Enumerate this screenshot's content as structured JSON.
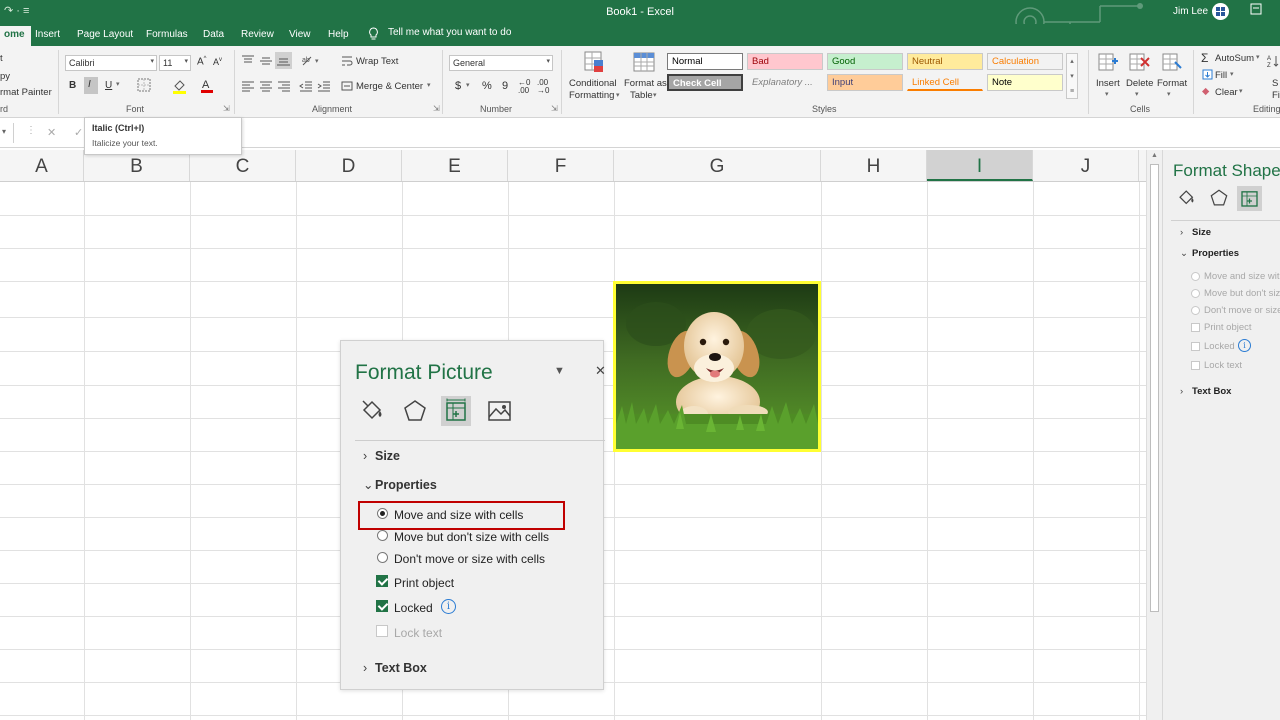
{
  "titlebar": {
    "title": "Book1  -  Excel",
    "user": "Jim Lee",
    "qa": "↷ ·  ≡"
  },
  "tabs": [
    {
      "label": "ome",
      "active": true
    },
    {
      "label": "Insert"
    },
    {
      "label": "Page Layout"
    },
    {
      "label": "Formulas"
    },
    {
      "label": "Data"
    },
    {
      "label": "Review"
    },
    {
      "label": "View"
    },
    {
      "label": "Help"
    }
  ],
  "tell_me": "Tell me what you want to do",
  "ribbon": {
    "clipboard": {
      "cut": "t",
      "copy": "py",
      "painter": "rmat Painter",
      "label": "rd"
    },
    "font": {
      "name": "Calibri",
      "size": "11",
      "bold": "B",
      "italic": "I",
      "underline": "U",
      "label": "Font"
    },
    "alignment": {
      "wrap": "Wrap Text",
      "merge": "Merge & Center",
      "label": "Alignment"
    },
    "number": {
      "format": "General",
      "currency": "$",
      "percent": "%",
      "comma": "9",
      "label": "Number"
    },
    "conditional": {
      "line1": "Conditional",
      "line2": "Formatting"
    },
    "format_table": {
      "line1": "Format as",
      "line2": "Table"
    },
    "styles": {
      "label": "Styles",
      "cells": [
        {
          "text": "Normal",
          "bg": "#ffffff",
          "color": "#000000"
        },
        {
          "text": "Bad",
          "bg": "#ffc7ce",
          "color": "#9c0006"
        },
        {
          "text": "Good",
          "bg": "#c6efce",
          "color": "#006100"
        },
        {
          "text": "Neutral",
          "bg": "#ffeb9c",
          "color": "#9c5700"
        },
        {
          "text": "Calculation",
          "bg": "#f2f2f2",
          "color": "#fa7d00"
        },
        {
          "text": "Check Cell",
          "bg": "#a5a5a5",
          "color": "#ffffff"
        },
        {
          "text": "Explanatory ...",
          "bg": "#f3f3f3",
          "color": "#7f7f7f"
        },
        {
          "text": "Input",
          "bg": "#ffcc99",
          "color": "#3f3f76"
        },
        {
          "text": "Linked Cell",
          "bg": "#f3f3f3",
          "color": "#fa7d00"
        },
        {
          "text": "Note",
          "bg": "#ffffcc",
          "color": "#000000"
        }
      ]
    },
    "cells": {
      "insert": "Insert",
      "delete": "Delete",
      "format": "Format",
      "label": "Cells"
    },
    "editing": {
      "autosum": "AutoSum",
      "fill": "Fill",
      "clear": "Clear",
      "label": "Editing",
      "sort1": "S",
      "sort2": "Fi"
    }
  },
  "tooltip": {
    "title": "Italic (Ctrl+I)",
    "desc": "Italicize your text."
  },
  "columns": [
    "A",
    "B",
    "C",
    "D",
    "E",
    "F",
    "G",
    "H",
    "I",
    "J"
  ],
  "selected_column": "I",
  "format_picture": {
    "title": "Format Picture",
    "size": "Size",
    "properties": "Properties",
    "options": {
      "move_size": "Move and size with cells",
      "move_only": "Move but don't size with cells",
      "dont_move": "Don't move or size with cells",
      "print": "Print object",
      "locked": "Locked",
      "lock_text": "Lock text"
    },
    "text_box": "Text Box"
  },
  "format_shape": {
    "title": "Format Shape",
    "size": "Size",
    "properties": "Properties",
    "options": {
      "move_size": "Move and size with",
      "move_only": "Move but don't size",
      "dont_move": "Don't move or size",
      "print": "Print object",
      "locked": "Locked",
      "lock_text": "Lock text"
    },
    "text_box": "Text Box"
  }
}
